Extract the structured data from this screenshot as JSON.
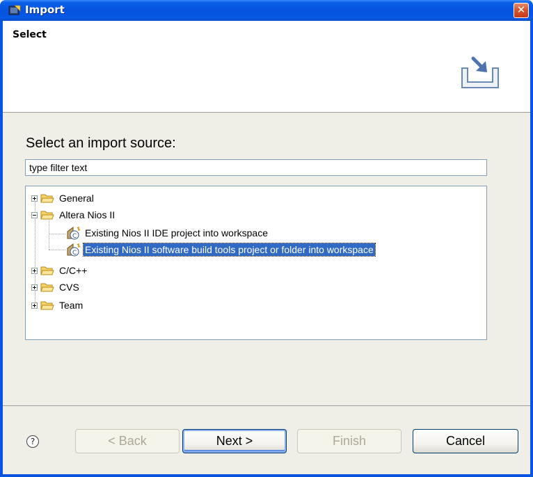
{
  "window": {
    "title": "Import"
  },
  "header": {
    "title": "Select"
  },
  "body": {
    "prompt": "Select an import source:",
    "filter": {
      "value": "type filter text",
      "placeholder": ""
    },
    "tree": [
      {
        "label": "General",
        "expanded": false,
        "level": 0,
        "kind": "folder"
      },
      {
        "label": "Altera Nios II",
        "expanded": true,
        "level": 0,
        "kind": "folder"
      },
      {
        "label": "Existing Nios II IDE project into workspace",
        "level": 1,
        "kind": "wizard"
      },
      {
        "label": "Existing Nios II software build tools project or folder into workspace",
        "level": 1,
        "kind": "wizard",
        "selected": true
      },
      {
        "label": "C/C++",
        "expanded": false,
        "level": 0,
        "kind": "folder"
      },
      {
        "label": "CVS",
        "expanded": false,
        "level": 0,
        "kind": "folder"
      },
      {
        "label": "Team",
        "expanded": false,
        "level": 0,
        "kind": "folder"
      }
    ]
  },
  "footer": {
    "help_glyph": "?",
    "back_label": "< Back",
    "next_label": "Next >",
    "finish_label": "Finish",
    "cancel_label": "Cancel"
  },
  "colors": {
    "titlebar": "#0653df",
    "selection": "#316ac5",
    "close": "#d8542c"
  }
}
